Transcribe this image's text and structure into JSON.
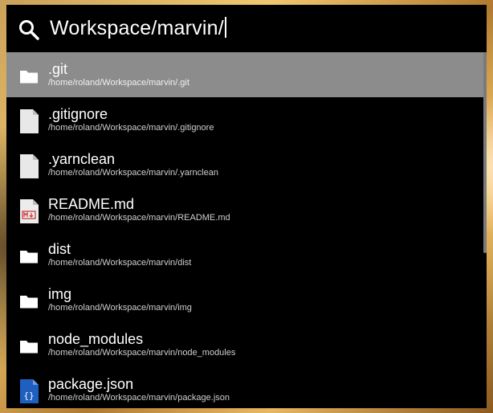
{
  "search": {
    "value": "Workspace/marvin/"
  },
  "results": [
    {
      "name": ".git",
      "path": "/home/roland/Workspace/marvin/.git",
      "icon": "folder-icon",
      "selected": true
    },
    {
      "name": ".gitignore",
      "path": "/home/roland/Workspace/marvin/.gitignore",
      "icon": "file-icon",
      "selected": false
    },
    {
      "name": ".yarnclean",
      "path": "/home/roland/Workspace/marvin/.yarnclean",
      "icon": "file-icon",
      "selected": false
    },
    {
      "name": "README.md",
      "path": "/home/roland/Workspace/marvin/README.md",
      "icon": "markdown-file-icon",
      "selected": false
    },
    {
      "name": "dist",
      "path": "/home/roland/Workspace/marvin/dist",
      "icon": "folder-icon",
      "selected": false
    },
    {
      "name": "img",
      "path": "/home/roland/Workspace/marvin/img",
      "icon": "folder-icon",
      "selected": false
    },
    {
      "name": "node_modules",
      "path": "/home/roland/Workspace/marvin/node_modules",
      "icon": "folder-icon",
      "selected": false
    },
    {
      "name": "package.json",
      "path": "/home/roland/Workspace/marvin/package.json",
      "icon": "json-file-icon",
      "selected": false
    }
  ],
  "colors": {
    "selected_row": "#8c8c8c",
    "background": "#000000",
    "json_icon": "#1f5fbf",
    "md_icon_accent": "#cc3333"
  }
}
